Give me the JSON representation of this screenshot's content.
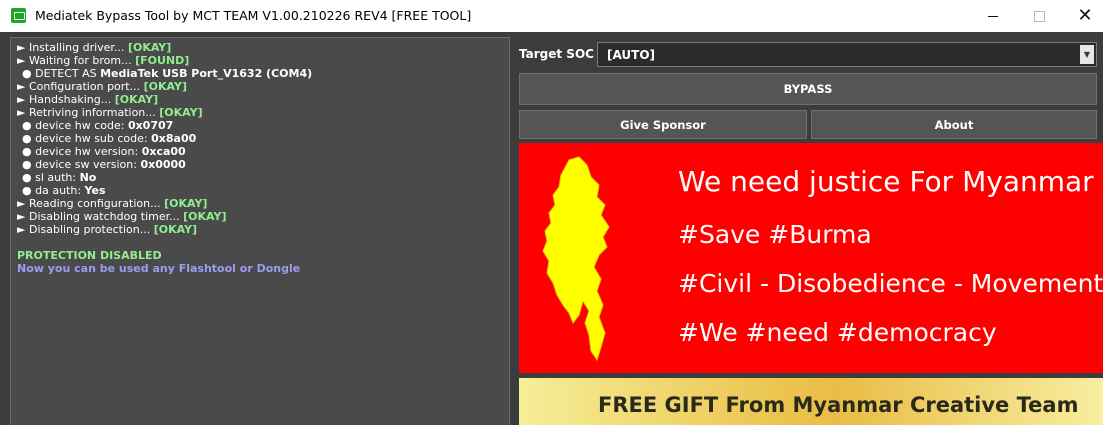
{
  "window": {
    "title": "Mediatek Bypass Tool by MCT TEAM V1.00.210226 REV4 [FREE TOOL]",
    "controls": {
      "minimize": "",
      "maximize": "",
      "close": "✕"
    }
  },
  "log": {
    "lines": [
      {
        "prefix": "► ",
        "text": "Installing driver... ",
        "status": "[OKAY]"
      },
      {
        "prefix": "► ",
        "text": "Waiting for brom... ",
        "status": "[FOUND]"
      },
      {
        "prefix": "● ",
        "text": "DETECT AS ",
        "value": "MediaTek USB Port_V1632 (COM4)"
      },
      {
        "prefix": "► ",
        "text": "Configuration port... ",
        "status": "[OKAY]"
      },
      {
        "prefix": "► ",
        "text": "Handshaking... ",
        "status": "[OKAY]"
      },
      {
        "prefix": "► ",
        "text": "Retriving information... ",
        "status": "[OKAY]"
      },
      {
        "prefix": "● ",
        "text": "device hw code: ",
        "value": "0x0707"
      },
      {
        "prefix": "● ",
        "text": "device hw sub code: ",
        "value": "0x8a00"
      },
      {
        "prefix": "● ",
        "text": "device hw version: ",
        "value": "0xca00"
      },
      {
        "prefix": "● ",
        "text": "device sw version: ",
        "value": "0x0000"
      },
      {
        "prefix": "● ",
        "text": "sl auth: ",
        "value": "No"
      },
      {
        "prefix": "● ",
        "text": "da auth: ",
        "value": "Yes"
      },
      {
        "prefix": "► ",
        "text": "Reading configuration... ",
        "status": "[OKAY]"
      },
      {
        "prefix": "► ",
        "text": "Disabling watchdog timer... ",
        "status": "[OKAY]"
      },
      {
        "prefix": "► ",
        "text": "Disabling protection... ",
        "status": "[OKAY]"
      }
    ],
    "result_title": "PROTECTION DISABLED",
    "result_message": "Now you can be used any Flashtool or Dongle"
  },
  "controls": {
    "soc_label": "Target SOC",
    "soc_value": "[AUTO]",
    "bypass_label": "BYPASS",
    "sponsor_label": "Give Sponsor",
    "about_label": "About"
  },
  "banner": {
    "line1": "We need justice For Myanmar",
    "line2": "#Save #Burma",
    "line3": "#Civil - Disobedience - Movement",
    "line4": "#We #need #democracy",
    "map_icon": "myanmar-map-icon",
    "bg_color": "#ff0000",
    "map_color": "#ffff00"
  },
  "gift": {
    "text": "FREE GIFT From Myanmar Creative Team"
  }
}
